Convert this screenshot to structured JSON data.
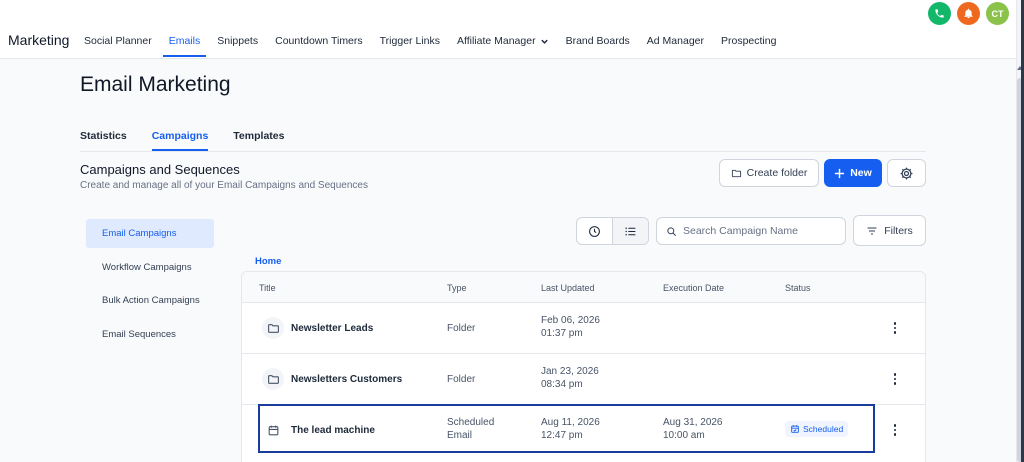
{
  "app": {
    "name": "Marketing"
  },
  "topnav": {
    "items": [
      {
        "label": "Social Planner"
      },
      {
        "label": "Emails",
        "active": true
      },
      {
        "label": "Snippets"
      },
      {
        "label": "Countdown Timers"
      },
      {
        "label": "Trigger Links"
      },
      {
        "label": "Affiliate Manager"
      },
      {
        "label": "Brand Boards"
      },
      {
        "label": "Ad Manager"
      },
      {
        "label": "Prospecting"
      }
    ]
  },
  "header_icons": {
    "phone": "phone-icon",
    "notifications": "bell-icon",
    "avatar_initials": "CT"
  },
  "page": {
    "title": "Email Marketing"
  },
  "subtabs": [
    {
      "label": "Statistics"
    },
    {
      "label": "Campaigns",
      "active": true
    },
    {
      "label": "Templates"
    }
  ],
  "section": {
    "title": "Campaigns and Sequences",
    "subtitle": "Create and manage all of your Email Campaigns and Sequences"
  },
  "actions": {
    "create_folder": "Create folder",
    "new": "New"
  },
  "sidenav": [
    {
      "label": "Email Campaigns",
      "active": true
    },
    {
      "label": "Workflow Campaigns"
    },
    {
      "label": "Bulk Action Campaigns"
    },
    {
      "label": "Email Sequences"
    }
  ],
  "search": {
    "placeholder": "Search Campaign Name"
  },
  "filters": {
    "label": "Filters"
  },
  "breadcrumb": {
    "home": "Home"
  },
  "table": {
    "columns": [
      "Title",
      "Type",
      "Last Updated",
      "Execution Date",
      "Status"
    ],
    "rows": [
      {
        "title": "Newsletter Leads",
        "icon": "folder-icon",
        "type": "Folder",
        "updated_date": "Feb 06, 2026",
        "updated_time": "01:37 pm",
        "exec_date": "",
        "exec_time": "",
        "status": ""
      },
      {
        "title": "Newsletters Customers",
        "icon": "folder-icon",
        "type": "Folder",
        "updated_date": "Jan 23, 2026",
        "updated_time": "08:34 pm",
        "exec_date": "",
        "exec_time": "",
        "status": ""
      },
      {
        "title": "The lead machine",
        "icon": "calendar-icon",
        "type": "Scheduled Email",
        "type_line1": "Scheduled",
        "type_line2": "Email",
        "updated_date": "Aug 11, 2026",
        "updated_time": "12:47 pm",
        "exec_date": "Aug 31, 2026",
        "exec_time": "10:00 am",
        "status": "Scheduled"
      }
    ]
  },
  "colors": {
    "accent": "#155eef",
    "highlight": "#1a3d9b",
    "phone": "#12b76a",
    "bell": "#ef6820",
    "avatar": "#8bc34a"
  }
}
